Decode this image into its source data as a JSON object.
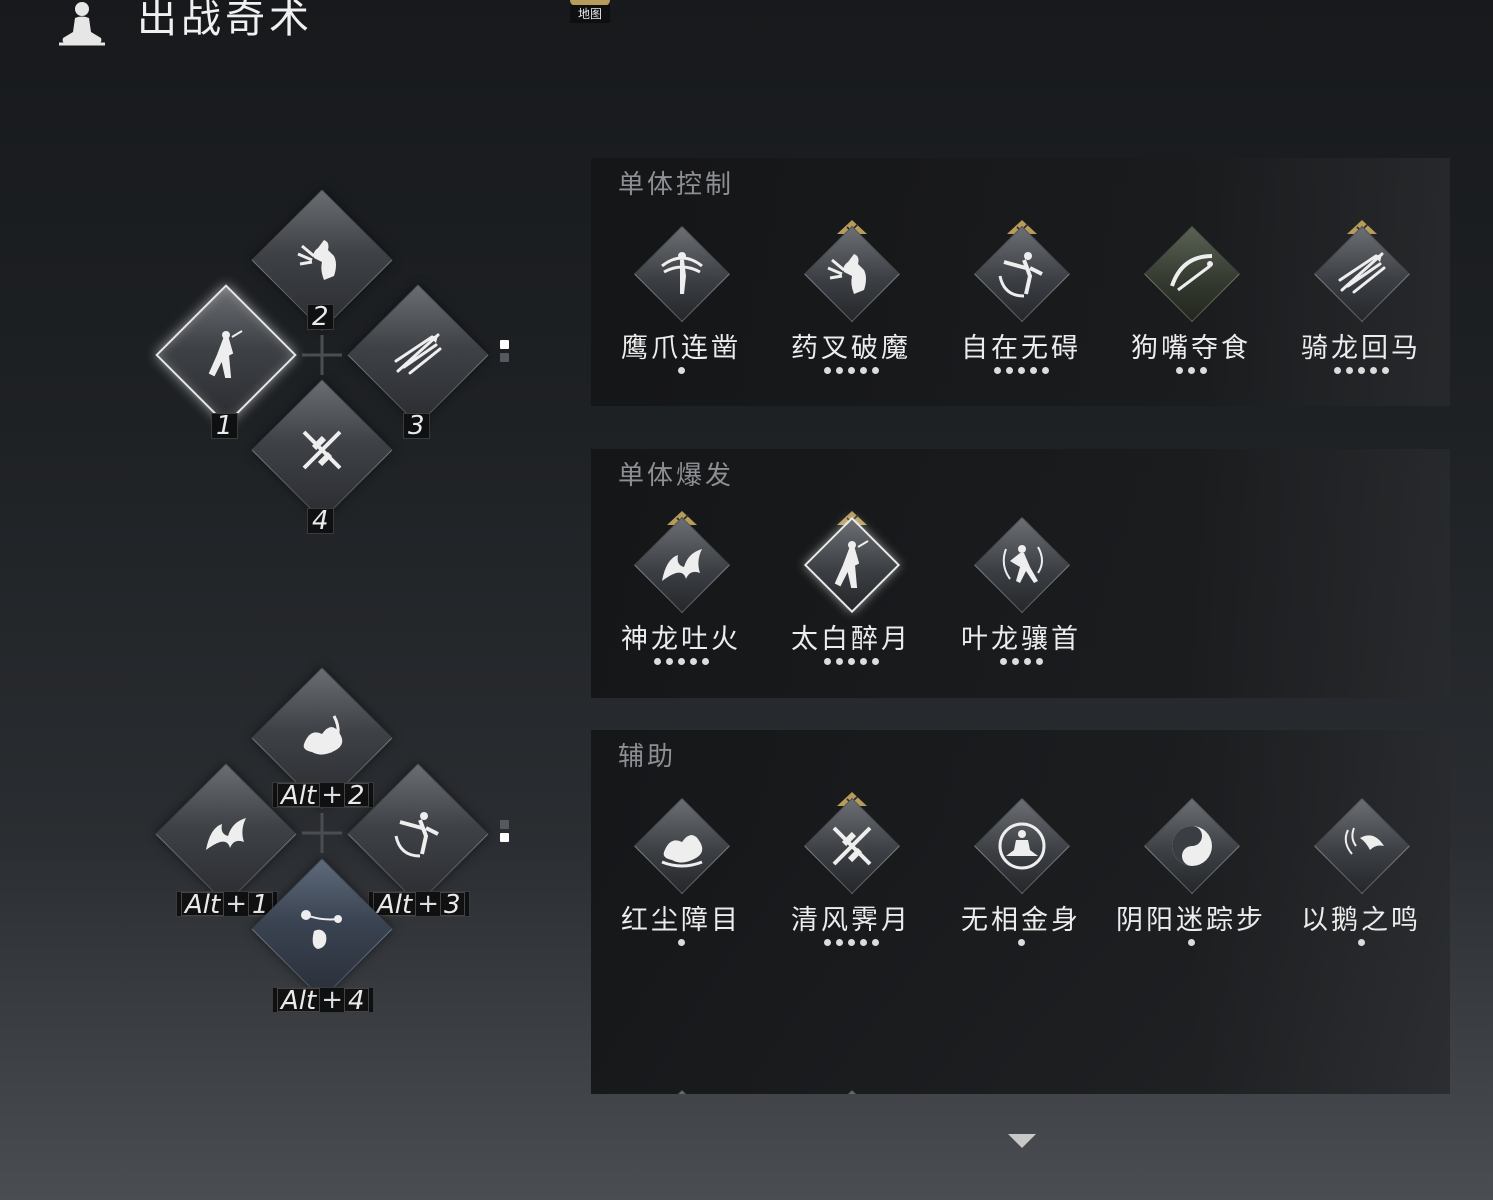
{
  "header": {
    "title": "出战奇术"
  },
  "map_button": {
    "label": "地图"
  },
  "loadout_primary": {
    "slots": [
      {
        "key": "2",
        "icon": "fist-strike-icon"
      },
      {
        "key": "1",
        "icon": "kick-stance-icon"
      },
      {
        "key": "3",
        "icon": "dart-volley-icon"
      },
      {
        "key": "4",
        "icon": "crossed-blades-icon"
      }
    ],
    "page_indicator": {
      "active": 0,
      "count": 2
    }
  },
  "loadout_alt": {
    "slots": [
      {
        "mod": "Alt",
        "key": "2",
        "icon": "smoke-burst-icon"
      },
      {
        "mod": "Alt",
        "key": "1",
        "icon": "dragon-flame-icon"
      },
      {
        "mod": "Alt",
        "key": "3",
        "icon": "flying-kick-icon"
      },
      {
        "mod": "Alt",
        "key": "4",
        "icon": "flail-icon"
      }
    ],
    "page_indicator": {
      "active": 1,
      "count": 2
    }
  },
  "categories": [
    {
      "title": "单体控制",
      "skills": [
        {
          "name": "鹰爪连凿",
          "level": 1,
          "equipped": false,
          "icon": "eagle-claw-icon"
        },
        {
          "name": "药叉破魔",
          "level": 5,
          "equipped": true,
          "icon": "fist-strike-icon"
        },
        {
          "name": "自在无碍",
          "level": 5,
          "equipped": true,
          "icon": "flying-kick-icon"
        },
        {
          "name": "狗嘴夺食",
          "level": 3,
          "equipped": false,
          "icon": "sweep-icon"
        },
        {
          "name": "骑龙回马",
          "level": 5,
          "equipped": true,
          "icon": "dart-volley-icon"
        }
      ]
    },
    {
      "title": "单体爆发",
      "skills": [
        {
          "name": "神龙吐火",
          "level": 5,
          "equipped": true,
          "icon": "dragon-flame-icon"
        },
        {
          "name": "太白醉月",
          "level": 5,
          "equipped": true,
          "selected": true,
          "icon": "kick-stance-icon"
        },
        {
          "name": "叶龙骧首",
          "level": 4,
          "equipped": false,
          "icon": "stance-icon"
        }
      ]
    },
    {
      "title": "辅助",
      "skills": [
        {
          "name": "红尘障目",
          "level": 1,
          "equipped": false,
          "icon": "smoke-burst-icon"
        },
        {
          "name": "清风霁月",
          "level": 5,
          "equipped": true,
          "icon": "crossed-blades-icon"
        },
        {
          "name": "无相金身",
          "level": 1,
          "equipped": false,
          "icon": "meditation-icon"
        },
        {
          "name": "阴阳迷踪步",
          "level": 1,
          "equipped": false,
          "icon": "yin-yang-icon"
        },
        {
          "name": "以鹅之鸣",
          "level": 1,
          "equipped": false,
          "icon": "goose-cry-icon"
        },
        {
          "name": "",
          "level": 0,
          "equipped": false,
          "icon": "spiral-icon"
        },
        {
          "name": "",
          "level": 0,
          "equipped": false,
          "icon": "caped-figure-icon"
        }
      ]
    }
  ],
  "colors": {
    "equipped_badge": "#b79b5a",
    "dot": "#dcdcdc",
    "panel_title": "#8d8f93"
  }
}
